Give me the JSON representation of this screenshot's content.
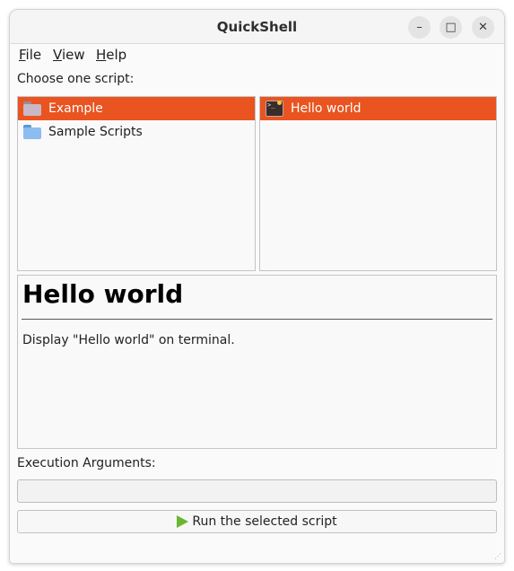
{
  "window": {
    "title": "QuickShell"
  },
  "window_controls": {
    "minimize_glyph": "–",
    "maximize_glyph": "□",
    "close_glyph": "✕"
  },
  "menu": {
    "items": [
      {
        "label": "File",
        "accel": "F",
        "rest": "ile"
      },
      {
        "label": "View",
        "accel": "V",
        "rest": "iew"
      },
      {
        "label": "Help",
        "accel": "H",
        "rest": "elp"
      }
    ]
  },
  "choose_label": "Choose one script:",
  "folders": [
    {
      "label": "Example",
      "icon": "folder-icon",
      "selected": true
    },
    {
      "label": "Sample Scripts",
      "icon": "folder-icon",
      "selected": false
    }
  ],
  "scripts": [
    {
      "label": "Hello world",
      "icon": "terminal-icon",
      "selected": true
    }
  ],
  "detail": {
    "heading": "Hello world",
    "description": "Display \"Hello world\" on terminal."
  },
  "execution": {
    "label": "Execution Arguments:",
    "value": "",
    "placeholder": ""
  },
  "run_button": {
    "label": "Run the selected script",
    "icon": "play-icon"
  },
  "colors": {
    "selection": "#e95420",
    "play": "#6bb52f"
  }
}
